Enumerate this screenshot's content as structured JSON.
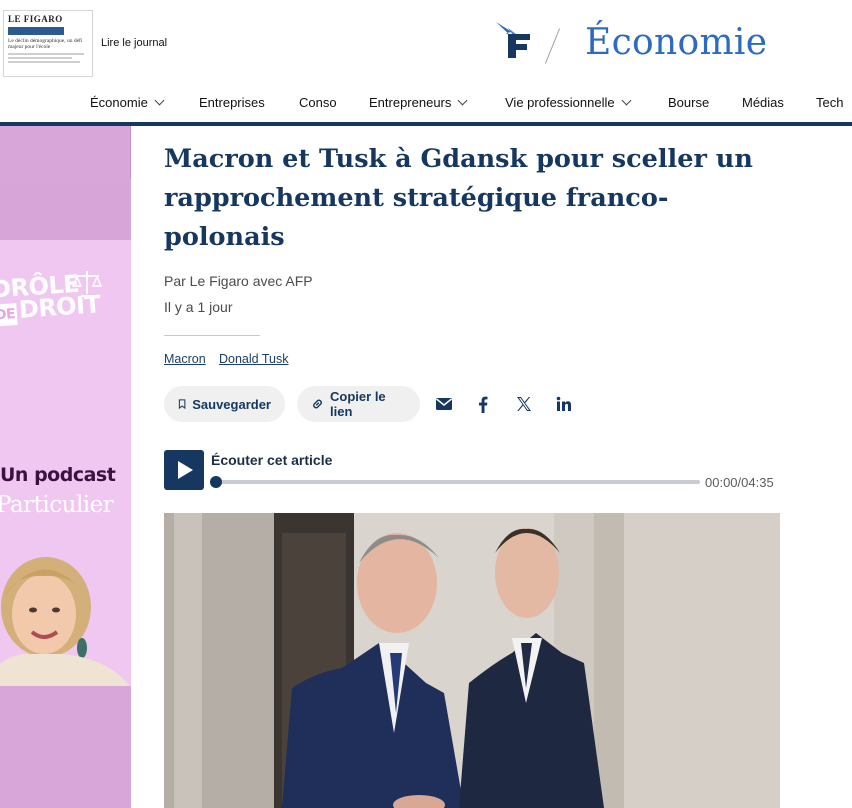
{
  "header": {
    "journal_masthead": "LE FIGARO",
    "journal_headline": "Le déclin démographique, un défi majeur pour l'école",
    "journal_link": "Lire le journal",
    "section_title": "Économie"
  },
  "nav": {
    "items": [
      {
        "label": "Économie",
        "dropdown": true
      },
      {
        "label": "Entreprises",
        "dropdown": false
      },
      {
        "label": "Conso",
        "dropdown": false
      },
      {
        "label": "Entrepreneurs",
        "dropdown": true
      },
      {
        "label": "Vie professionnelle",
        "dropdown": true
      },
      {
        "label": "Bourse",
        "dropdown": false
      },
      {
        "label": "Médias",
        "dropdown": false
      },
      {
        "label": "Tech",
        "dropdown": false
      }
    ]
  },
  "ad": {
    "drole": "DRÔLE",
    "de": "DE",
    "droit": "DROIT",
    "podcast": "Un podcast",
    "brand": "Particulier"
  },
  "article": {
    "title": "Macron et Tusk à Gdansk pour sceller un rapprochement stratégique franco-polonais",
    "byline": "Par Le Figaro avec AFP",
    "time": "Il y a 1 jour",
    "tags": [
      "Macron",
      "Donald Tusk"
    ],
    "save_label": "Sauvegarder",
    "copy_label": "Copier le lien",
    "share_icons": [
      "mail-icon",
      "facebook-icon",
      "x-icon",
      "linkedin-icon"
    ]
  },
  "player": {
    "label": "Écouter cet article",
    "time": "00:00/04:35",
    "progress": 0
  },
  "colors": {
    "brand_navy": "#163860",
    "section_blue": "#2c6bbf",
    "ad_pink": "#f0c7f0"
  }
}
